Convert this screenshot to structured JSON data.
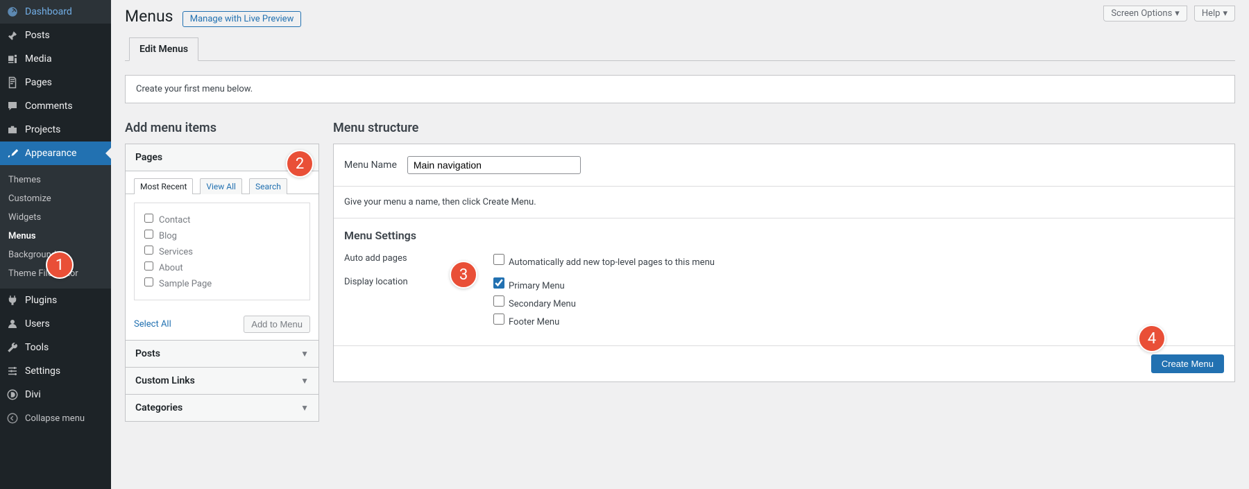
{
  "sidebar": {
    "items": [
      {
        "id": "dashboard",
        "label": "Dashboard"
      },
      {
        "id": "posts",
        "label": "Posts"
      },
      {
        "id": "media",
        "label": "Media"
      },
      {
        "id": "pages",
        "label": "Pages"
      },
      {
        "id": "comments",
        "label": "Comments"
      },
      {
        "id": "projects",
        "label": "Projects"
      },
      {
        "id": "appearance",
        "label": "Appearance"
      },
      {
        "id": "plugins",
        "label": "Plugins"
      },
      {
        "id": "users",
        "label": "Users"
      },
      {
        "id": "tools",
        "label": "Tools"
      },
      {
        "id": "settings",
        "label": "Settings"
      },
      {
        "id": "divi",
        "label": "Divi"
      }
    ],
    "appearance_sub": [
      {
        "id": "themes",
        "label": "Themes"
      },
      {
        "id": "customize",
        "label": "Customize"
      },
      {
        "id": "widgets",
        "label": "Widgets"
      },
      {
        "id": "menus",
        "label": "Menus",
        "active": true
      },
      {
        "id": "background",
        "label": "Background"
      },
      {
        "id": "theme-file-editor",
        "label": "Theme File Editor"
      }
    ],
    "collapse_label": "Collapse menu"
  },
  "top_right": {
    "screen_options": "Screen Options",
    "help": "Help"
  },
  "header": {
    "title": "Menus",
    "action": "Manage with Live Preview",
    "tab": "Edit Menus",
    "notice": "Create your first menu below."
  },
  "add_items": {
    "heading": "Add menu items",
    "section_pages": "Pages",
    "filter_tabs": [
      "Most Recent",
      "View All",
      "Search"
    ],
    "pages": [
      "Contact",
      "Blog",
      "Services",
      "About",
      "Sample Page"
    ],
    "select_all": "Select All",
    "add_to_menu": "Add to Menu",
    "section_posts": "Posts",
    "section_links": "Custom Links",
    "section_categories": "Categories"
  },
  "structure": {
    "heading": "Menu structure",
    "name_label": "Menu Name",
    "name_value": "Main navigation",
    "help_text": "Give your menu a name, then click Create Menu.",
    "settings_heading": "Menu Settings",
    "auto_label": "Auto add pages",
    "auto_option": "Automatically add new top-level pages to this menu",
    "display_label": "Display location",
    "loc_primary": "Primary Menu",
    "loc_secondary": "Secondary Menu",
    "loc_footer": "Footer Menu",
    "create_button": "Create Menu"
  },
  "badges": {
    "b1": "1",
    "b2": "2",
    "b3": "3",
    "b4": "4"
  }
}
